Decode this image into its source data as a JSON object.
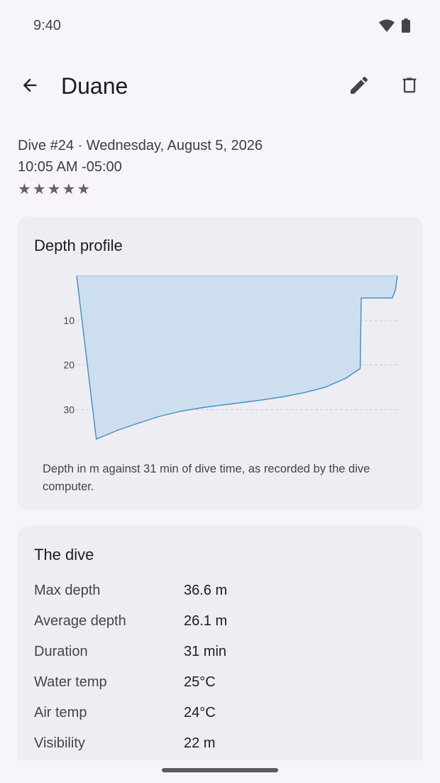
{
  "status_bar": {
    "time": "9:40",
    "icons": [
      "wifi-icon",
      "battery-icon"
    ]
  },
  "app_bar": {
    "title": "Duane",
    "icons": [
      "arrow-back-icon",
      "edit-icon",
      "delete-icon"
    ]
  },
  "dive": {
    "summary_line": "Dive #24 · Wednesday, August 5, 2026",
    "time_line": "10:05 AM -05:00",
    "rating": 5,
    "star_glyph": "★"
  },
  "depth_card": {
    "title": "Depth profile",
    "caption": "Depth in m against 31 min of dive time, as recorded by the dive computer."
  },
  "chart_data": {
    "type": "area",
    "title": "Depth profile",
    "xlabel": "",
    "ylabel": "",
    "x_unit": "min",
    "y_unit": "m",
    "y_inverted": true,
    "xlim": [
      0,
      31
    ],
    "ylim": [
      0,
      36.6
    ],
    "y_ticks": [
      "10",
      "20",
      "30"
    ],
    "grid": "horizontal dashed",
    "fill_color": "#cddfef",
    "line_color": "#3c8fbf",
    "series": [
      {
        "x": [
          0,
          1.9,
          4,
          6,
          8,
          10,
          12,
          14,
          16,
          18,
          20,
          22,
          24,
          26,
          27.4,
          27.5,
          30.5,
          30.8,
          31
        ],
        "y": [
          0,
          36.6,
          34.6,
          33.0,
          31.5,
          30.4,
          29.6,
          29.0,
          28.4,
          27.8,
          27.1,
          26.2,
          25.0,
          23.0,
          20.8,
          5.0,
          5.0,
          3.3,
          0
        ]
      }
    ]
  },
  "dive_card": {
    "title": "The dive",
    "stats": [
      {
        "label": "Max depth",
        "value": "36.6 m"
      },
      {
        "label": "Average depth",
        "value": "26.1 m"
      },
      {
        "label": "Duration",
        "value": "31 min"
      },
      {
        "label": "Water temp",
        "value": "25°C"
      },
      {
        "label": "Air temp",
        "value": "24°C"
      },
      {
        "label": "Visibility",
        "value": "22 m"
      }
    ]
  }
}
